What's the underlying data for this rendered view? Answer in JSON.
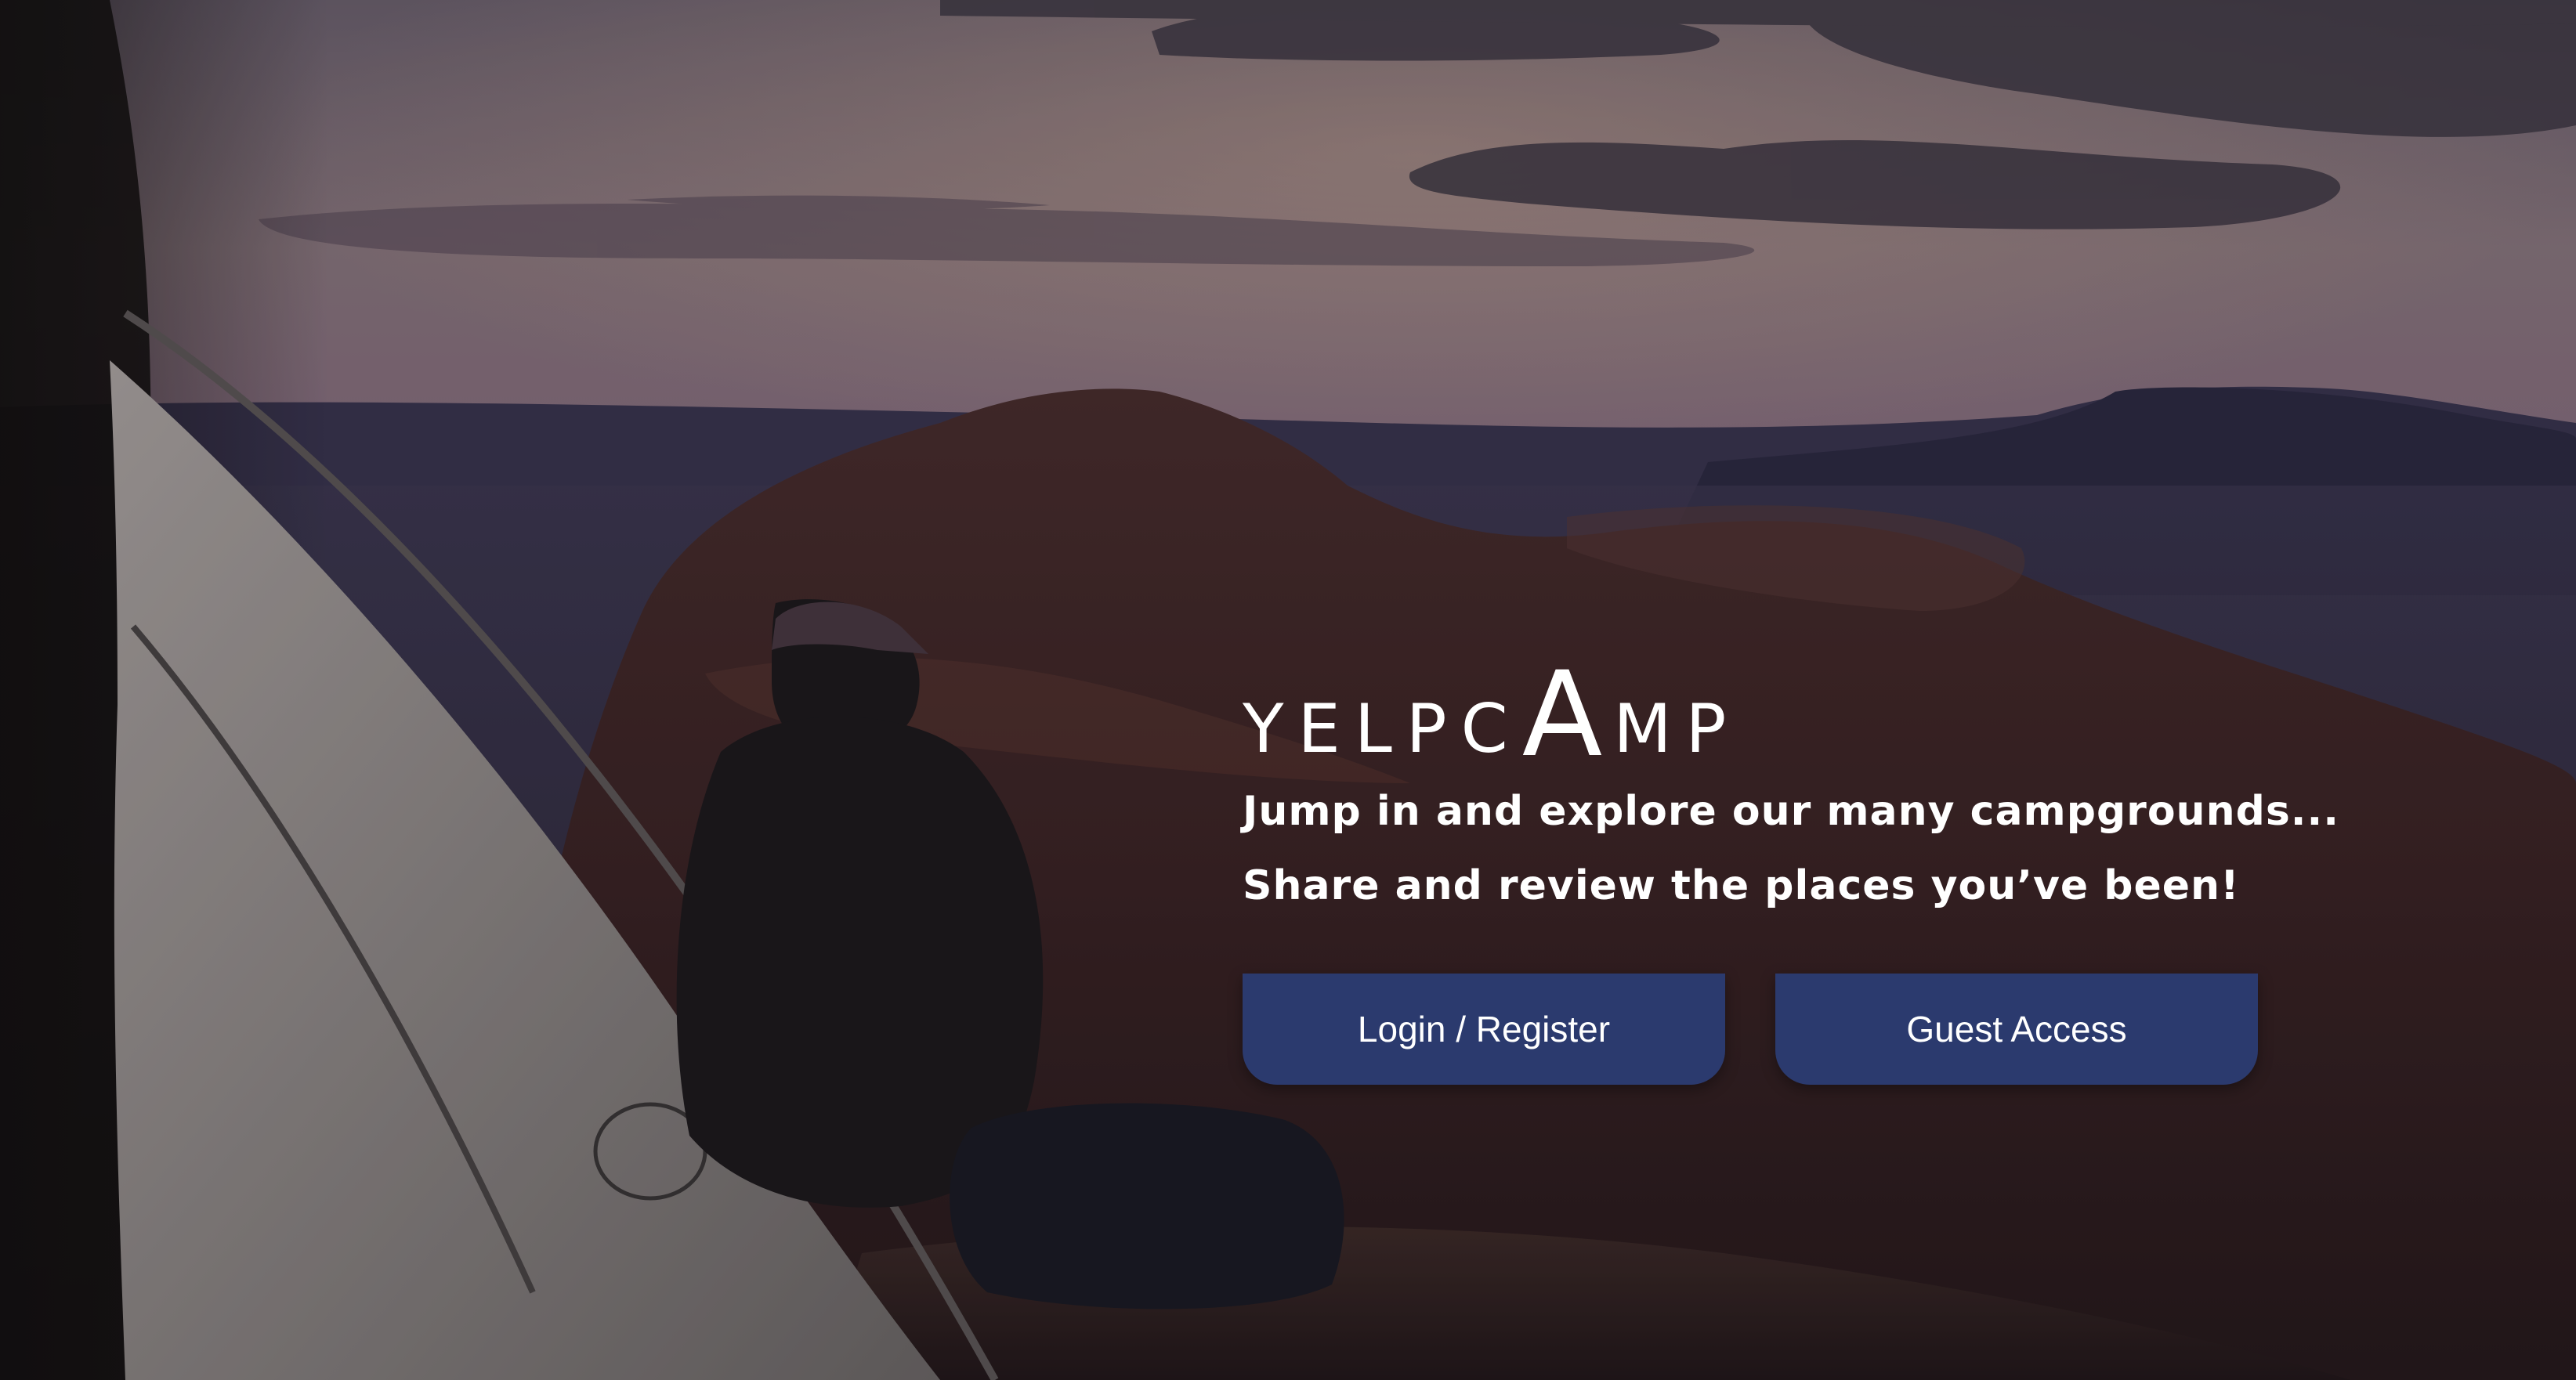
{
  "brand": {
    "logo_text_before": "YELPC",
    "logo_text_accent": "A",
    "logo_text_after": "MP"
  },
  "hero": {
    "tagline_1": "Jump in and explore our many campgrounds...",
    "tagline_2": "Share and review the places you’ve been!"
  },
  "actions": {
    "login_label": "Login / Register",
    "guest_label": "Guest Access"
  },
  "colors": {
    "button_background": "#2b3a6e",
    "text": "#ffffff"
  }
}
